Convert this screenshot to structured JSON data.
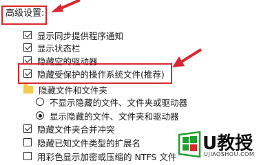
{
  "section": {
    "heading": "高级设置:"
  },
  "options": [
    {
      "label": "显示同步提供程序通知",
      "control": "checkbox",
      "checked": true
    },
    {
      "label": "显示状态栏",
      "control": "checkbox",
      "checked": true
    },
    {
      "label": "隐藏空的驱动器",
      "control": "checkbox",
      "checked": true
    },
    {
      "label": "隐藏受保护的操作系统文件(推荐)",
      "control": "checkbox",
      "checked": true,
      "highlighted": true
    },
    {
      "label": "隐藏文件和文件夹",
      "control": "folder-group"
    },
    {
      "label": "不显示隐藏的文件、文件夹或驱动器",
      "control": "radio",
      "checked": false
    },
    {
      "label": "显示隐藏的文件、文件夹和驱动器",
      "control": "radio",
      "checked": true
    },
    {
      "label": "隐藏文件夹合并冲突",
      "control": "checkbox",
      "checked": true
    },
    {
      "label": "隐藏已知文件类型的扩展名",
      "control": "checkbox",
      "checked": false
    },
    {
      "label": "用彩色显示加密或压缩的 NTFS 文件",
      "control": "checkbox",
      "checked": false
    }
  ],
  "annotation": {
    "highlight_color": "#d9272e"
  },
  "watermark": {
    "brand": "U教授",
    "url": "UJIAOSHOU.COM",
    "logo_colors": [
      "#1fa02f",
      "#d9272e"
    ]
  }
}
